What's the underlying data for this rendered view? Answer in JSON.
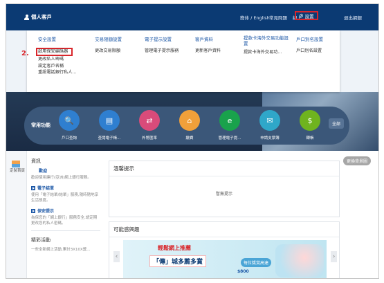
{
  "header": {
    "brand": "個人客戶",
    "links": {
      "language": "簡体 / English",
      "faq": "常見問題",
      "online": "線上",
      "share": "問",
      "settings": "設置",
      "logout": "退出網銀"
    }
  },
  "dropdown": {
    "step_label": "2.",
    "columns": [
      {
        "heading": "安全設置",
        "items": [
          "啟用保安編碼器",
          "更改私人密碼",
          "設定客戶名稱",
          "重設電話銀行私人..."
        ]
      },
      {
        "heading": "交易限額設置",
        "items": [
          "更改交易限額"
        ]
      },
      {
        "heading": "電子提示設置",
        "items": [
          "管理電子提示服務"
        ]
      },
      {
        "heading": "客戶資料",
        "items": [
          "更新客戶資料"
        ]
      },
      {
        "heading": "提款卡海外交易功能設置",
        "items": [
          "提款卡海外交易功..."
        ]
      },
      {
        "heading": "戶口別名設置",
        "items": [
          "戶口別名設置"
        ]
      }
    ],
    "highlighted_item": "啟用保安編碼器"
  },
  "hero": {
    "change_background": "更換背景圖"
  },
  "quick": {
    "title": "常用功能",
    "items": [
      {
        "label": "戶口查詢",
        "icon": "account-search-icon",
        "color": "#2f7fd0"
      },
      {
        "label": "查閱電子帳...",
        "icon": "statement-icon",
        "color": "#2f7fd0"
      },
      {
        "label": "外幣匯率",
        "icon": "exchange-icon",
        "color": "#d94b7a"
      },
      {
        "label": "繳費",
        "icon": "bill-payment-icon",
        "color": "#f0a03a"
      },
      {
        "label": "管理電子提...",
        "icon": "e-notification-icon",
        "color": "#19a24c"
      },
      {
        "label": "申請支票簿",
        "icon": "chequebook-icon",
        "color": "#2fa7c9"
      },
      {
        "label": "轉帳",
        "icon": "transfer-icon",
        "color": "#6fb31f"
      }
    ],
    "more": "全部"
  },
  "rail": {
    "label": "定製首頁"
  },
  "news": {
    "heading": "資訊",
    "welcome_title": "歡迎",
    "welcome_text": "歡迎使用建行(亞洲)網上銀行服務。",
    "link1": "電子結單",
    "link1_text": "使用「電子結單/結單」服務,隨時隨地享生活態度。",
    "link2": "保安提示",
    "link2_text": "為保您的「網上銀行」服務安全,請定期更改您的私人密碼。",
    "heading2": "精彩活動",
    "text2": "一些全新網上活動,累計3X10X獎..."
  },
  "panels": {
    "notice_title": "溫馨提示",
    "notice_empty": "暫無提示",
    "interest_title": "可能感興趣",
    "promo_title": "輕鬆網上推薦",
    "promo_sub": "「傳」城多薦多賞",
    "promo_tag": "每位獎賞高達",
    "promo_tag2": "$800"
  },
  "colors": {
    "navy": "#0b3a73",
    "highlight_red": "#d9262b",
    "link_blue": "#1a56a6"
  }
}
